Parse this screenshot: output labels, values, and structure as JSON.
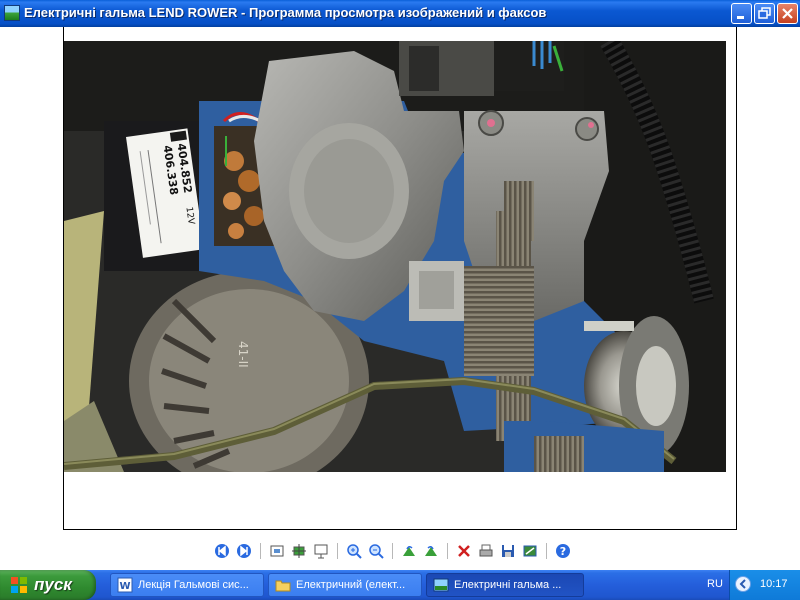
{
  "window": {
    "title": "Електричні гальма  LEND ROWER - Программа просмотра изображений и факсов",
    "icon": "image-viewer-icon"
  },
  "controls": [
    "minimize-icon",
    "maximize-icon",
    "close-icon"
  ],
  "photo": {
    "label_line1": "404.852",
    "label_line2": "406.338",
    "label_volt": "12V",
    "accent": "#2f5fa0"
  },
  "toolbar": {
    "buttons": [
      "previous-image-icon",
      "next-image-icon",
      "best-fit-icon",
      "actual-size-icon",
      "slideshow-icon",
      "zoom-in-icon",
      "zoom-out-icon",
      "rotate-clockwise-icon",
      "rotate-counterclockwise-icon",
      "delete-icon",
      "print-icon",
      "save-icon",
      "edit-icon",
      "help-icon"
    ]
  },
  "taskbar": {
    "start_label": "пуск",
    "items": [
      {
        "label": "Лекція Гальмові сис...",
        "icon": "word-document-icon"
      },
      {
        "label": "Електричний (елект...",
        "icon": "folder-icon"
      },
      {
        "label": "Електричні гальма  ...",
        "icon": "image-viewer-icon",
        "active": true
      }
    ],
    "language": "RU",
    "clock": "10:17"
  }
}
